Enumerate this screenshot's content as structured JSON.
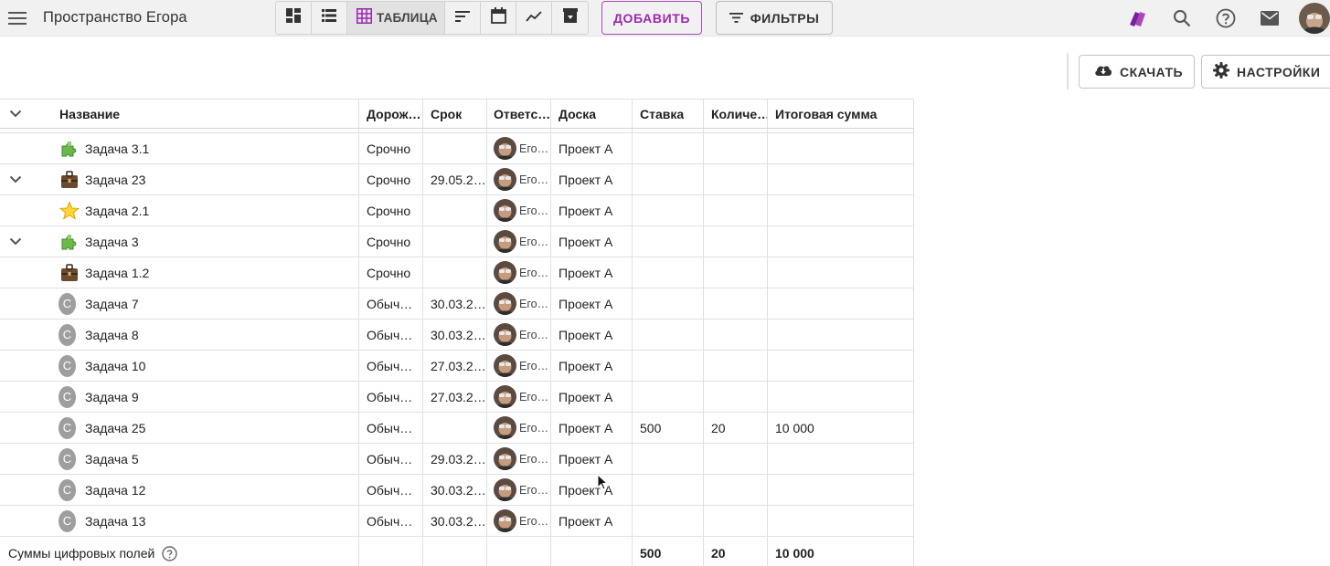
{
  "topbar": {
    "menu_icon": "menu-icon",
    "title": "Пространство Егора",
    "views": [
      {
        "icon": "dashboard-icon"
      },
      {
        "icon": "list-icon"
      },
      {
        "icon": "table-icon",
        "label": "ТАБЛИЦА",
        "active": true
      },
      {
        "icon": "sort-icon"
      },
      {
        "icon": "calendar-icon"
      },
      {
        "icon": "chart-icon"
      },
      {
        "icon": "archive-icon"
      }
    ],
    "add_label": "ДОБАВИТЬ",
    "filters_label": "ФИЛЬТРЫ",
    "right_icons": [
      "brand-icon",
      "search-icon",
      "help-icon",
      "mail-icon",
      "avatar"
    ],
    "accent_color": "#9c27b0"
  },
  "toolbar": {
    "download_label": "СКАЧАТЬ",
    "settings_label": "НАСТРОЙКИ"
  },
  "table": {
    "columns": {
      "name": "Название",
      "road": "Дорож…",
      "due": "Срок",
      "responsible": "Ответс…",
      "board": "Доска",
      "rate": "Ставка",
      "qty": "Количе…",
      "total": "Итоговая сумма"
    },
    "rows": [
      {
        "expand": false,
        "icon": "puzzle-icon",
        "name": "Задача 3.1",
        "road": "Срочно",
        "due": "",
        "resp": "Его…",
        "board": "Проект А",
        "rate": "",
        "qty": "",
        "total": ""
      },
      {
        "expand": true,
        "icon": "briefcase-icon",
        "name": "Задача 23",
        "road": "Срочно",
        "due": "29.05.2…",
        "resp": "Его…",
        "board": "Проект А",
        "rate": "",
        "qty": "",
        "total": ""
      },
      {
        "expand": false,
        "icon": "star-icon",
        "name": "Задача 2.1",
        "road": "Срочно",
        "due": "",
        "resp": "Его…",
        "board": "Проект А",
        "rate": "",
        "qty": "",
        "total": ""
      },
      {
        "expand": true,
        "icon": "puzzle-icon",
        "name": "Задача 3",
        "road": "Срочно",
        "due": "",
        "resp": "Его…",
        "board": "Проект А",
        "rate": "",
        "qty": "",
        "total": ""
      },
      {
        "expand": false,
        "icon": "briefcase-icon",
        "name": "Задача 1.2",
        "road": "Срочно",
        "due": "",
        "resp": "Его…",
        "board": "Проект А",
        "rate": "",
        "qty": "",
        "total": ""
      },
      {
        "expand": false,
        "icon": "letter",
        "letter": "C",
        "name": "Задача 7",
        "road": "Обыч…",
        "due": "30.03.2…",
        "resp": "Его…",
        "board": "Проект А",
        "rate": "",
        "qty": "",
        "total": ""
      },
      {
        "expand": false,
        "icon": "letter",
        "letter": "C",
        "name": "Задача 8",
        "road": "Обыч…",
        "due": "30.03.2…",
        "resp": "Его…",
        "board": "Проект А",
        "rate": "",
        "qty": "",
        "total": ""
      },
      {
        "expand": false,
        "icon": "letter",
        "letter": "C",
        "name": "Задача 10",
        "road": "Обыч…",
        "due": "27.03.2…",
        "resp": "Его…",
        "board": "Проект А",
        "rate": "",
        "qty": "",
        "total": ""
      },
      {
        "expand": false,
        "icon": "letter",
        "letter": "C",
        "name": "Задача 9",
        "road": "Обыч…",
        "due": "27.03.2…",
        "resp": "Его…",
        "board": "Проект А",
        "rate": "",
        "qty": "",
        "total": ""
      },
      {
        "expand": false,
        "icon": "letter",
        "letter": "C",
        "name": "Задача 25",
        "road": "Обыч…",
        "due": "",
        "resp": "Его…",
        "board": "Проект А",
        "rate": "500",
        "qty": "20",
        "total": "10 000"
      },
      {
        "expand": false,
        "icon": "letter",
        "letter": "C",
        "name": "Задача 5",
        "road": "Обыч…",
        "due": "29.03.2…",
        "resp": "Его…",
        "board": "Проект А",
        "rate": "",
        "qty": "",
        "total": ""
      },
      {
        "expand": false,
        "icon": "letter",
        "letter": "C",
        "name": "Задача 12",
        "road": "Обыч…",
        "due": "30.03.2…",
        "resp": "Его…",
        "board": "Проект А",
        "rate": "",
        "qty": "",
        "total": ""
      },
      {
        "expand": false,
        "icon": "letter",
        "letter": "C",
        "name": "Задача 13",
        "road": "Обыч…",
        "due": "30.03.2…",
        "resp": "Его…",
        "board": "Проект А",
        "rate": "",
        "qty": "",
        "total": ""
      }
    ],
    "footer": {
      "label": "Суммы цифровых полей",
      "rate": "500",
      "qty": "20",
      "total": "10 000"
    }
  }
}
